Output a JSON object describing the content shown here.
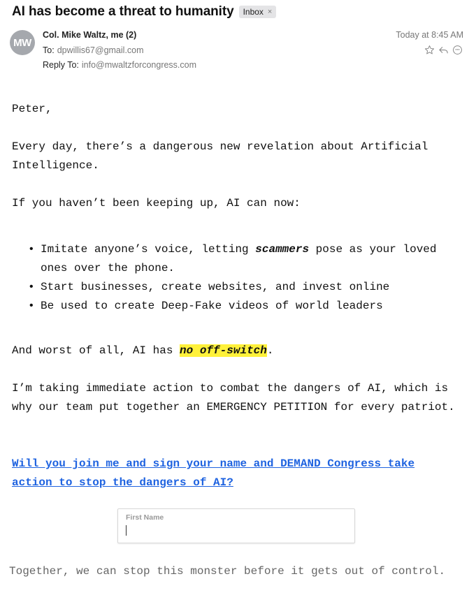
{
  "email": {
    "subject": "AI has become a threat to humanity",
    "badge": "Inbox",
    "badge_close": "×",
    "avatar_initials": "MW",
    "from": "Col. Mike Waltz, me (2)",
    "to_label": "To:",
    "to": "dpwillis67@gmail.com",
    "reply_label": "Reply To:",
    "reply_to": "info@mwaltzforcongress.com",
    "date": "Today at 8:45 AM",
    "icons": [
      "star-icon",
      "reply-icon",
      "smiley-icon"
    ]
  },
  "body": {
    "greeting": "Peter,",
    "intro": "Every day, there’s a dangerous new revelation about Artificial Intelligence.",
    "lead": "If you haven’t been keeping up, AI can now:",
    "bullets": [
      {
        "pre": "Imitate anyone’s voice, letting ",
        "emph": "scammers",
        "post": " pose as your loved ones over the phone."
      },
      {
        "text": "Start businesses, create websites, and invest online"
      },
      {
        "text": "Be used to create Deep-Fake videos of world leaders"
      }
    ],
    "worst_pre": "And worst of all, AI has ",
    "worst_highlight": "no off-switch",
    "worst_post": ".",
    "action": "I’m taking immediate action to combat the dangers of AI, which is why our team put together an EMERGENCY PETITION for every patriot.",
    "link": "Will you join me and sign your name and DEMAND Congress take action to stop the dangers of AI?",
    "first_name_label": "First Name",
    "closing": "Together, we can stop this monster before it gets out of control."
  },
  "colors": {
    "link": "#1f63e0",
    "highlight": "#fff13a",
    "avatar": "#a5a8ad",
    "muted": "#777777"
  }
}
